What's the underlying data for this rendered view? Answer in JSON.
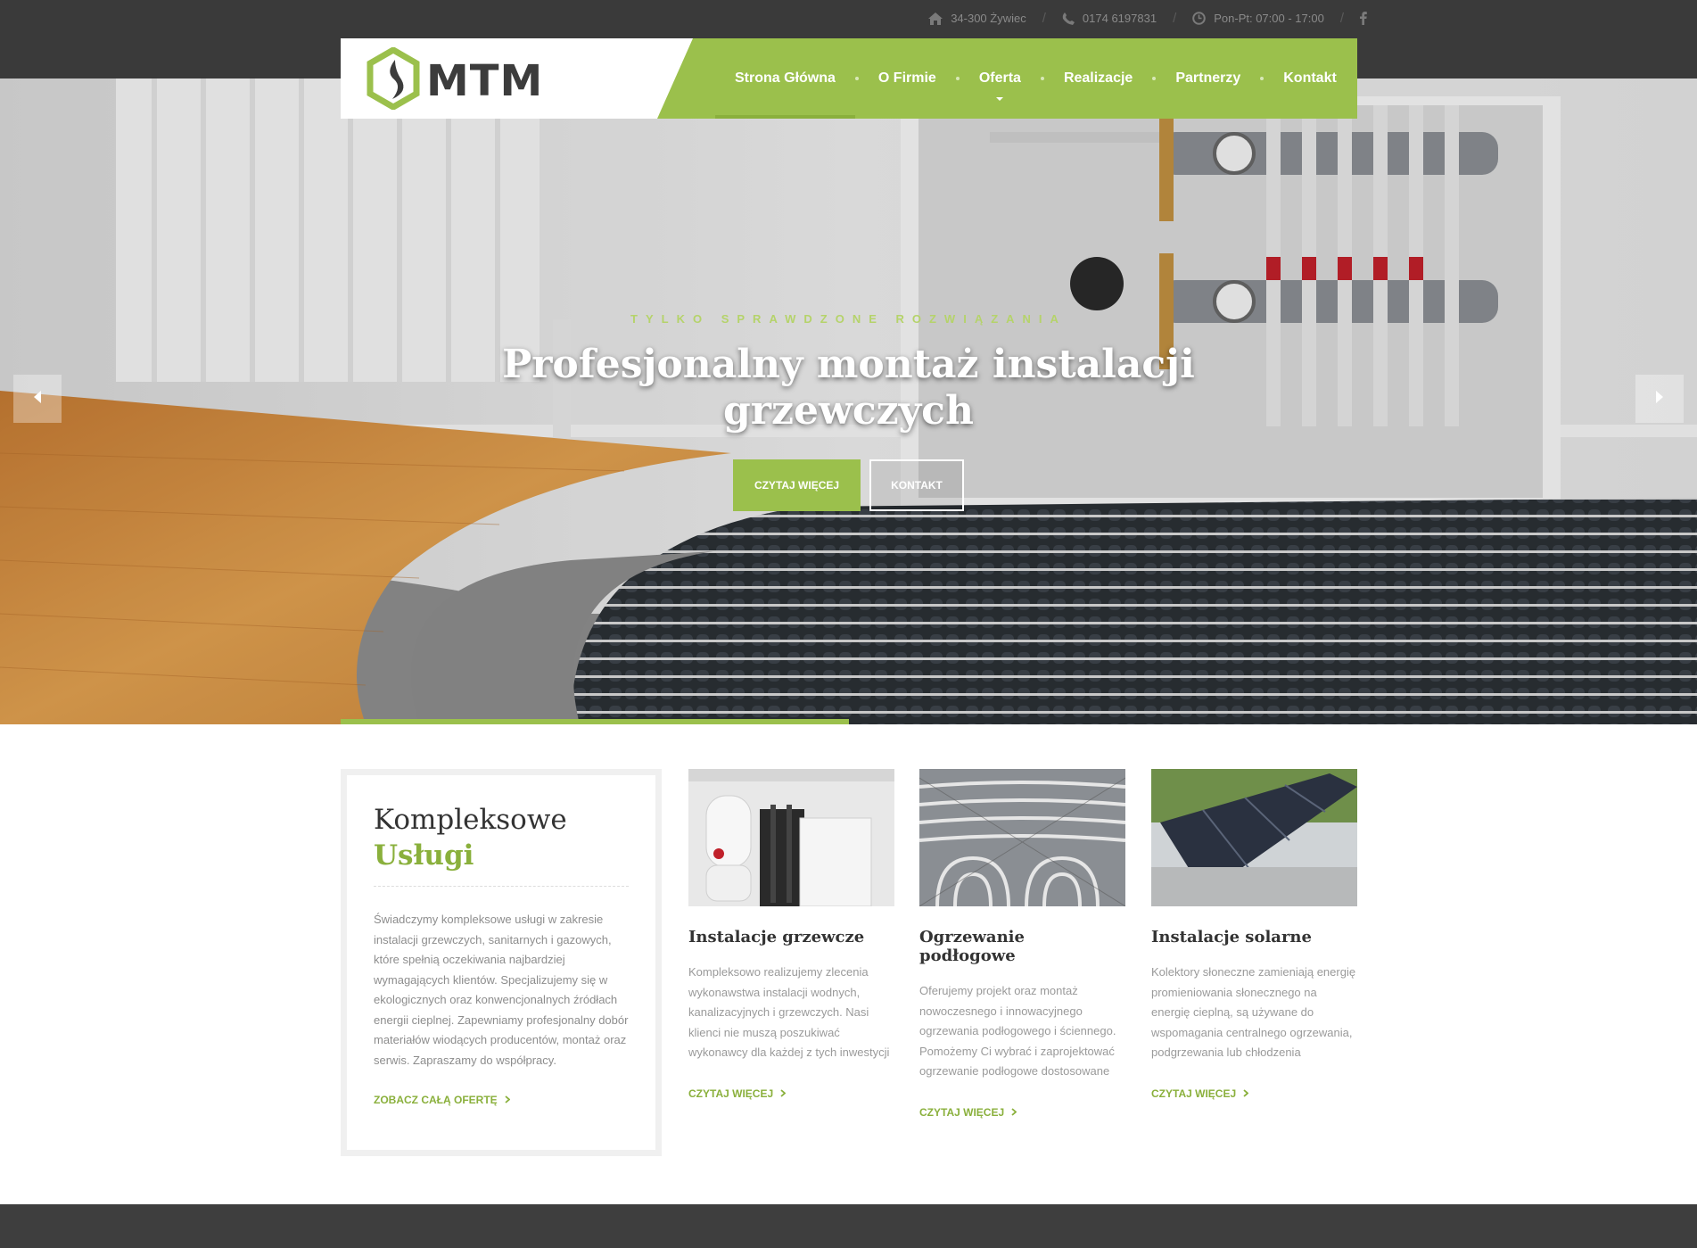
{
  "topbar": {
    "address": "34-300 Żywiec",
    "phone": "0174 6197831",
    "hours": "Pon-Pt: 07:00 - 17:00",
    "separator": "/"
  },
  "logo": {
    "text": "MTM"
  },
  "nav": [
    {
      "label": "Strona Główna",
      "active": true
    },
    {
      "label": "O Firmie"
    },
    {
      "label": "Oferta",
      "has_dropdown": true
    },
    {
      "label": "Realizacje"
    },
    {
      "label": "Partnerzy"
    },
    {
      "label": "Kontakt"
    }
  ],
  "hero": {
    "subtitle": "TYLKO SPRAWDZONE ROZWIĄZANIA",
    "title": "Profesjonalny montaż instalacji grzewczych",
    "btn_primary": "CZYTAJ WIĘCEJ",
    "btn_secondary": "KONTAKT"
  },
  "intro": {
    "title_line1": "Kompleksowe",
    "title_line2": "Usługi",
    "text": "Świadczymy kompleksowe usługi w zakresie instalacji grzewczych, sanitarnych i gazowych, które spełnią oczekiwania najbardziej wymagających klientów. Specjalizujemy się w ekologicznych oraz konwencjonalnych źródłach energii cieplnej. Zapewniamy profesjonalny dobór materiałów wiodących producentów, montaż oraz serwis. Zapraszamy do współpracy.",
    "link": "ZOBACZ CAŁĄ OFERTĘ"
  },
  "cards": [
    {
      "title": "Instalacje grzewcze",
      "text": "Kompleksowo realizujemy zlecenia wykonawstwa instalacji wodnych, kanalizacyjnych i grzewczych. Nasi klienci nie muszą poszukiwać wykonawcy dla każdej z tych inwestycji osobno, nasza...",
      "link": "CZYTAJ WIĘCEJ"
    },
    {
      "title": "Ogrzewanie podłogowe",
      "text": "Oferujemy projekt oraz montaż nowoczesnego i innowacyjnego ogrzewania podłogowego i ściennego. Pomożemy Ci wybrać i zaprojektować ogrzewanie podłogowe dostosowane do",
      "link": "CZYTAJ WIĘCEJ"
    },
    {
      "title": "Instalacje solarne",
      "text": "Kolektory słoneczne zamieniają energię promieniowania słonecznego na energię cieplną, są używane do wspomagania centralnego ogrzewania, podgrzewania lub chłodzenia",
      "link": "CZYTAJ WIĘCEJ"
    }
  ],
  "colors": {
    "brand_green": "#9bc04c",
    "dark_bar": "#3a3a3a",
    "text_gray": "#8d8d8d"
  },
  "icons": [
    "home-icon",
    "phone-icon",
    "clock-icon",
    "facebook-icon",
    "chevron-left-icon",
    "chevron-right-icon",
    "chevron-right-small-icon"
  ]
}
